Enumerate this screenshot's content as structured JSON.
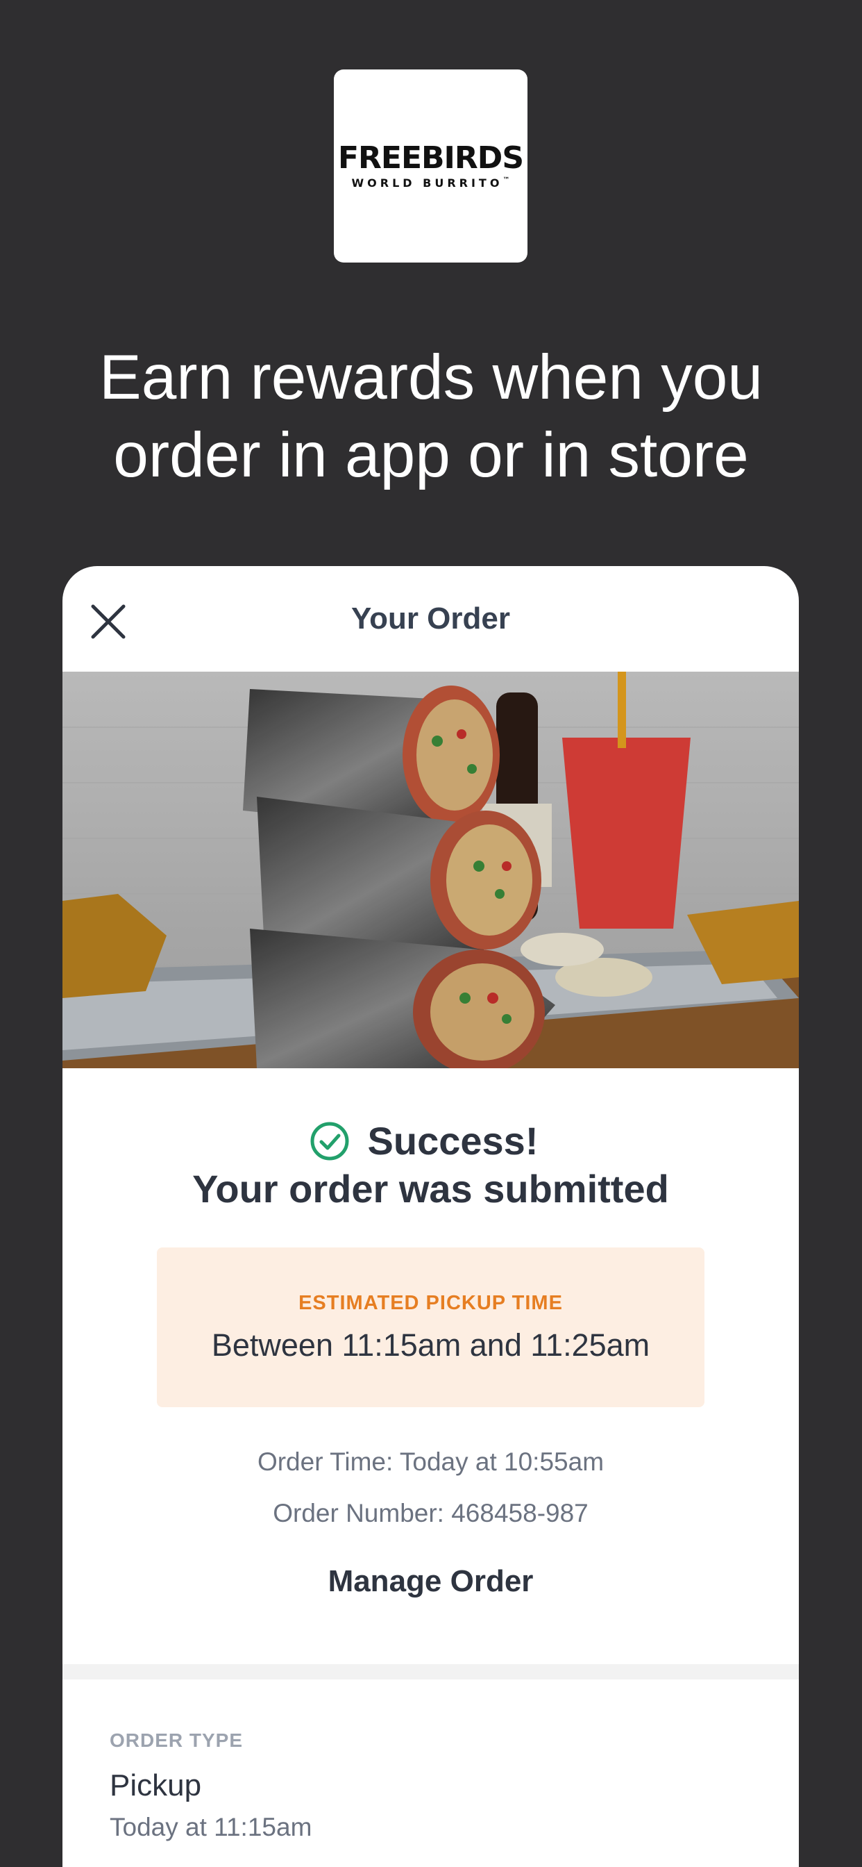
{
  "brand": {
    "logo_word": "FREEBIRDS",
    "logo_sub": "WORLD BURRITO",
    "logo_tm": "™",
    "accent": "#e8731c"
  },
  "headline": {
    "line1": "Earn rewards when you",
    "line2": "order in app or in store"
  },
  "sheet": {
    "title": "Your Order",
    "close_icon": "close-icon",
    "hero_image": "burrito-platter-photo"
  },
  "status": {
    "icon": "check-circle-icon",
    "icon_color": "#22a06b",
    "success_label": "Success!",
    "message": "Your order was submitted"
  },
  "pickup": {
    "label": "ESTIMATED PICKUP TIME",
    "value": "Between 11:15am and 11:25am",
    "label_color": "#e67e22",
    "bg_color": "#fdeee2"
  },
  "details": {
    "order_time": "Order Time: Today at 10:55am",
    "order_number": "Order Number: 468458-987"
  },
  "actions": {
    "manage_label": "Manage Order"
  },
  "order_type": {
    "label": "ORDER TYPE",
    "value": "Pickup",
    "time": "Today at 11:15am"
  },
  "colors": {
    "background": "#2f2e30",
    "card": "#ffffff",
    "text_dark": "#2e3440",
    "text_muted": "#6b7280"
  }
}
